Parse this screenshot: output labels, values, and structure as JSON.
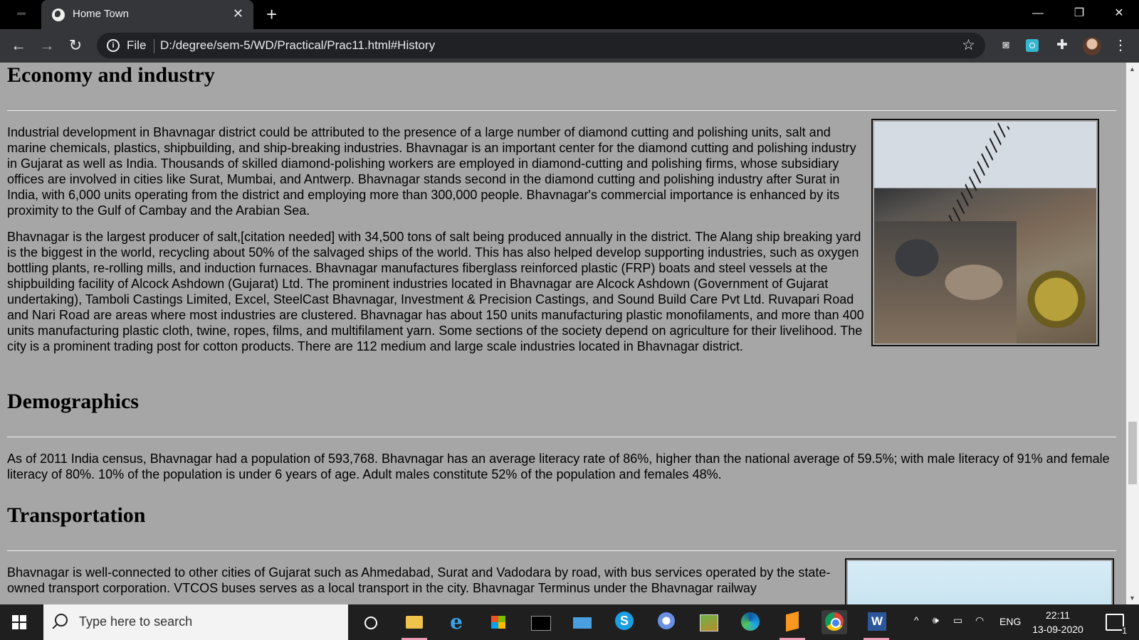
{
  "browser": {
    "tab_title": "Home Town",
    "new_tab_symbol": "+",
    "scheme_label": "File",
    "url": "D:/degree/sem-5/WD/Practical/Prac11.html#History",
    "window_controls": {
      "minimize": "—",
      "maximize": "❐",
      "close": "✕"
    },
    "icons": [
      "globe-icon",
      "close-icon",
      "back-icon",
      "forward-icon",
      "reload-icon",
      "info-icon",
      "star-icon",
      "camera-icon",
      "extension-box-icon",
      "puzzle-icon",
      "avatar",
      "more-menu-icon"
    ]
  },
  "page": {
    "sections": [
      {
        "heading": "Economy and industry",
        "paragraphs": [
          "Industrial development in Bhavnagar district could be attributed to the presence of a large number of diamond cutting and polishing units, salt and marine chemicals, plastics, shipbuilding, and ship-breaking industries. Bhavnagar is an important center for the diamond cutting and polishing industry in Gujarat as well as India. Thousands of skilled diamond-polishing workers are employed in diamond-cutting and polishing firms, whose subsidiary offices are involved in cities like Surat, Mumbai, and Antwerp. Bhavnagar stands second in the diamond cutting and polishing industry after Surat in India, with 6,000 units operating from the district and employing more than 300,000 people. Bhavnagar's commercial importance is enhanced by its proximity to the Gulf of Cambay and the Arabian Sea.",
          "Bhavnagar is the largest producer of salt,[citation needed] with 34,500 tons of salt being produced annually in the district. The Alang ship breaking yard is the biggest in the world, recycling about 50% of the salvaged ships of the world. This has also helped develop supporting industries, such as oxygen bottling plants, re-rolling mills, and induction furnaces. Bhavnagar manufactures fiberglass reinforced plastic (FRP) boats and steel vessels at the shipbuilding facility of Alcock Ashdown (Gujarat) Ltd. The prominent industries located in Bhavnagar are Alcock Ashdown (Government of Gujarat undertaking), Tamboli Castings Limited, Excel, SteelCast Bhavnagar, Investment & Precision Castings, and Sound Build Care Pvt Ltd. Ruvapari Road and Nari Road are areas where most industries are clustered. Bhavnagar has about 150 units manufacturing plastic monofilaments, and more than 400 units manufacturing plastic cloth, twine, ropes, films, and multifilament yarn. Some sections of the society depend on agriculture for their livelihood. The city is a prominent trading post for cotton products. There are 112 medium and large scale industries located in Bhavnagar district."
        ],
        "image": "ship-breaking-yard-photo"
      },
      {
        "heading": "Demographics",
        "paragraphs": [
          "As of 2011 India census, Bhavnagar had a population of 593,768. Bhavnagar has an average literacy rate of 86%, higher than the national average of 59.5%; with male literacy of 91% and female literacy of 80%. 10% of the population is under 6 years of age. Adult males constitute 52% of the population and females 48%."
        ]
      },
      {
        "heading": "Transportation",
        "paragraphs": [
          "Bhavnagar is well-connected to other cities of Gujarat such as Ahmedabad, Surat and Vadodara by road, with bus services operated by the state-owned transport corporation. VTCOS buses serves as a local transport in the city. Bhavnagar Terminus under the Bhavnagar railway"
        ],
        "image": "transport-photo"
      }
    ]
  },
  "taskbar": {
    "search_placeholder": "Type here to search",
    "apps": [
      "cortana",
      "file-explorer",
      "internet-explorer",
      "microsoft-store",
      "terminal",
      "mail",
      "skype",
      "chromium",
      "photos",
      "edge",
      "sublime-text",
      "chrome",
      "word"
    ],
    "ie_glyph": "e",
    "tray": {
      "chevron": "^",
      "volume": "🕪",
      "battery": "▭",
      "wifi": "◠",
      "language": "ENG"
    },
    "time": "22:11",
    "date": "13-09-2020",
    "notification_count": "1"
  }
}
